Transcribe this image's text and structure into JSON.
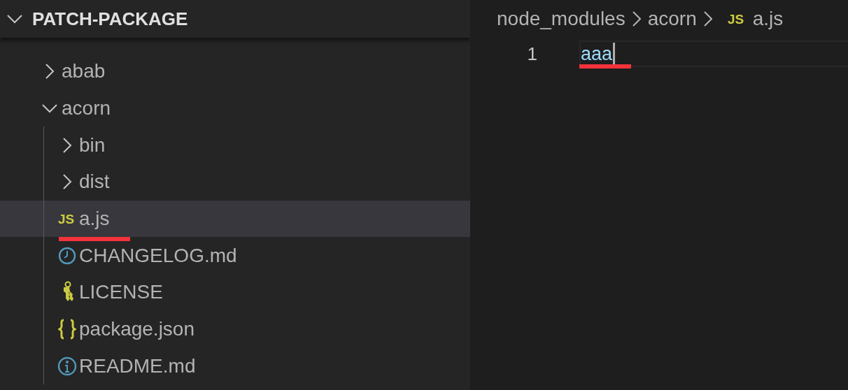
{
  "explorer": {
    "title": "PATCH-PACKAGE",
    "expanded": true,
    "tree": [
      {
        "label": "abab",
        "kind": "folder",
        "expanded": false,
        "selected": false
      },
      {
        "label": "acorn",
        "kind": "folder",
        "expanded": true,
        "selected": false,
        "children": [
          {
            "label": "bin",
            "kind": "folder",
            "expanded": false,
            "selected": false
          },
          {
            "label": "dist",
            "kind": "folder",
            "expanded": false,
            "selected": false
          },
          {
            "label": "a.js",
            "kind": "js",
            "icon_text": "JS",
            "selected": true,
            "underlined": true
          },
          {
            "label": "CHANGELOG.md",
            "kind": "clock",
            "selected": false
          },
          {
            "label": "LICENSE",
            "kind": "key",
            "selected": false
          },
          {
            "label": "package.json",
            "kind": "braces",
            "selected": false
          },
          {
            "label": "README.md",
            "kind": "info",
            "selected": false
          }
        ]
      }
    ]
  },
  "editor": {
    "breadcrumbs": [
      {
        "label": "node_modules",
        "kind": "folder"
      },
      {
        "label": "acorn",
        "kind": "folder"
      },
      {
        "label": "a.js",
        "kind": "js",
        "icon_text": "JS"
      }
    ],
    "lines": [
      {
        "number": "1",
        "code": "aaa",
        "current": true,
        "underlined": true
      }
    ]
  }
}
